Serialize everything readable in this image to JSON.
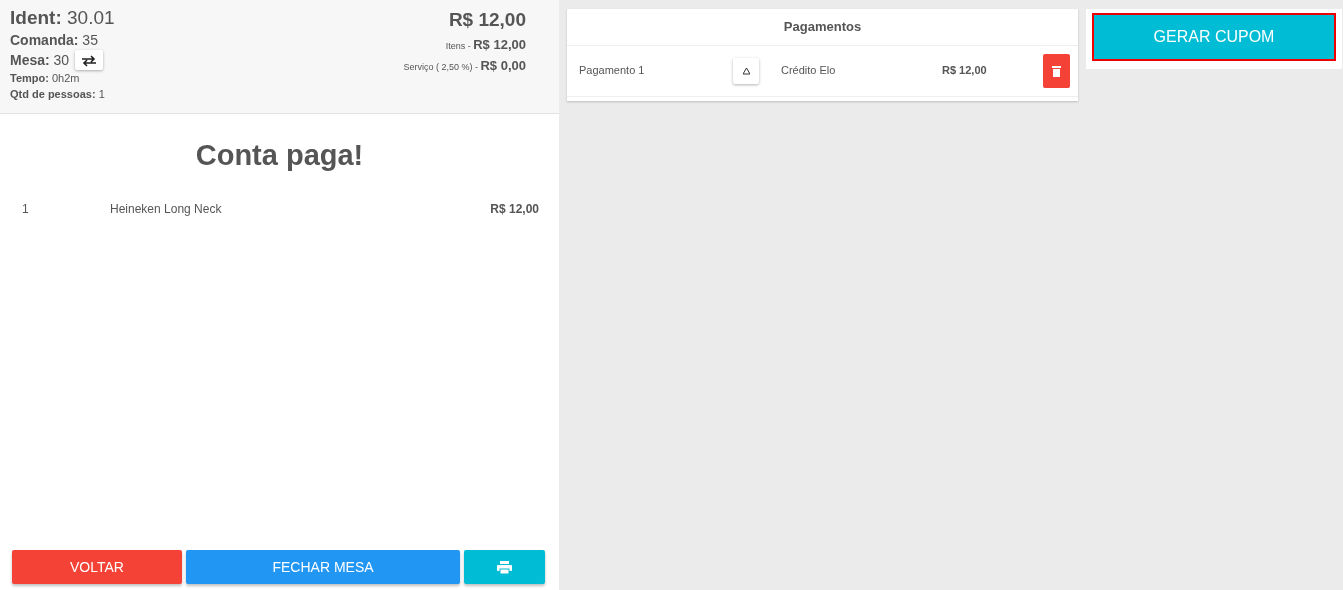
{
  "header": {
    "fields": [
      {
        "text": "**Ident:** 30.01",
        "kind": "title"
      },
      {
        "text": "**Comanda:** 35",
        "kind": "main"
      },
      {
        "text": "**Mesa:** 30",
        "kind": "main",
        "swap_button": true
      },
      {
        "text": "**Tempo:** 0h2m",
        "kind": "note"
      },
      {
        "text": "**Qtd de pessoas:** 1",
        "kind": "note"
      }
    ],
    "total": "R$ 12,00",
    "subtotals": [
      {
        "label": "Itens -",
        "value": "R$ 12,00"
      },
      {
        "label": "Serviço ( 2,50 %) -",
        "value": "R$ 0,00"
      }
    ]
  },
  "status_title": "Conta paga!",
  "items": [
    {
      "qty": "1",
      "name": "Heineken Long Neck",
      "price": "R$ 12,00"
    }
  ],
  "actions": [
    {
      "kind": "danger",
      "label": "VOLTAR"
    },
    {
      "kind": "primary",
      "label": "FECHAR MESA"
    },
    {
      "kind": "print"
    }
  ],
  "payments": {
    "title": "Pagamentos",
    "rows": [
      {
        "name": "Pagamento 1",
        "method": "Crédito Elo",
        "amount": "R$ 12,00"
      }
    ]
  },
  "coupon_button": {
    "label": "GERAR CUPOM",
    "focused": true
  }
}
